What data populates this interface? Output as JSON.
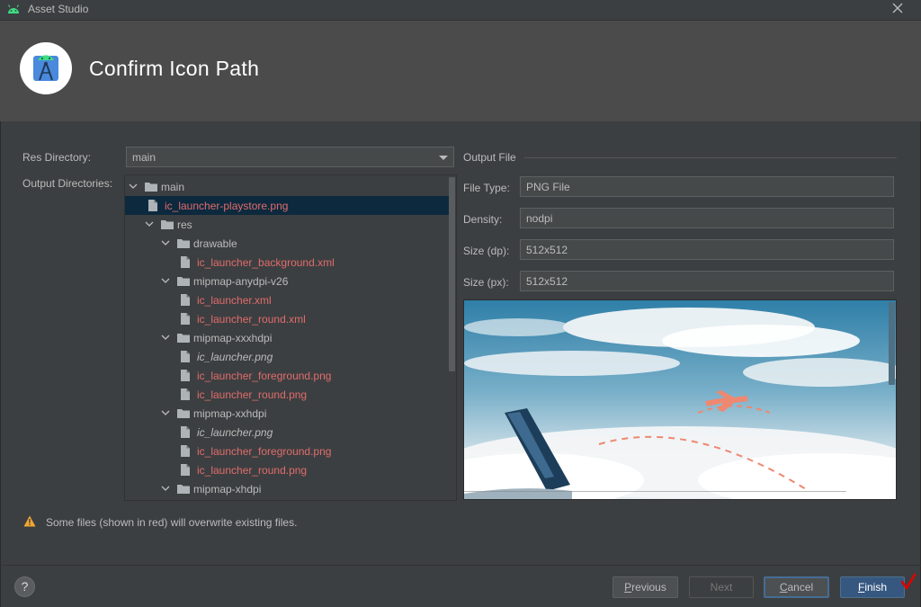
{
  "window": {
    "title": "Asset Studio"
  },
  "header": {
    "title": "Confirm Icon Path"
  },
  "form": {
    "res_directory_label": "Res Directory:",
    "res_directory_value": "main",
    "output_directories_label": "Output Directories:"
  },
  "tree": {
    "items": [
      {
        "label": "main",
        "kind": "folder",
        "depth": 0,
        "expanded": true,
        "style": "plain"
      },
      {
        "label": "ic_launcher-playstore.png",
        "kind": "file",
        "depth": 1,
        "style": "red",
        "selected": true
      },
      {
        "label": "res",
        "kind": "folder",
        "depth": 1,
        "expanded": true,
        "style": "plain"
      },
      {
        "label": "drawable",
        "kind": "folder",
        "depth": 2,
        "expanded": true,
        "style": "plain"
      },
      {
        "label": "ic_launcher_background.xml",
        "kind": "file",
        "depth": 3,
        "style": "red"
      },
      {
        "label": "mipmap-anydpi-v26",
        "kind": "folder",
        "depth": 2,
        "expanded": true,
        "style": "plain"
      },
      {
        "label": "ic_launcher.xml",
        "kind": "file",
        "depth": 3,
        "style": "red"
      },
      {
        "label": "ic_launcher_round.xml",
        "kind": "file",
        "depth": 3,
        "style": "red"
      },
      {
        "label": "mipmap-xxxhdpi",
        "kind": "folder",
        "depth": 2,
        "expanded": true,
        "style": "plain"
      },
      {
        "label": "ic_launcher.png",
        "kind": "file",
        "depth": 3,
        "style": "italic"
      },
      {
        "label": "ic_launcher_foreground.png",
        "kind": "file",
        "depth": 3,
        "style": "red"
      },
      {
        "label": "ic_launcher_round.png",
        "kind": "file",
        "depth": 3,
        "style": "red"
      },
      {
        "label": "mipmap-xxhdpi",
        "kind": "folder",
        "depth": 2,
        "expanded": true,
        "style": "plain"
      },
      {
        "label": "ic_launcher.png",
        "kind": "file",
        "depth": 3,
        "style": "italic"
      },
      {
        "label": "ic_launcher_foreground.png",
        "kind": "file",
        "depth": 3,
        "style": "red"
      },
      {
        "label": "ic_launcher_round.png",
        "kind": "file",
        "depth": 3,
        "style": "red"
      },
      {
        "label": "mipmap-xhdpi",
        "kind": "folder",
        "depth": 2,
        "expanded": true,
        "style": "plain"
      }
    ]
  },
  "output_file": {
    "section_title": "Output File",
    "file_type_label": "File Type:",
    "file_type_value": "PNG File",
    "density_label": "Density:",
    "density_value": "nodpi",
    "size_dp_label": "Size (dp):",
    "size_dp_value": "512x512",
    "size_px_label": "Size (px):",
    "size_px_value": "512x512"
  },
  "warning": {
    "text": "Some files (shown in red) will overwrite existing files."
  },
  "buttons": {
    "help": "?",
    "previous_mnemonic": "P",
    "previous_rest": "revious",
    "next": "Next",
    "cancel_mnemonic": "C",
    "cancel_rest": "ancel",
    "finish_mnemonic": "F",
    "finish_rest": "inish"
  },
  "colors": {
    "background": "#3c3f41",
    "header": "#4b4b4b",
    "overwrite_red": "#e06c6c",
    "selection": "#0d293e",
    "primary_button": "#365880",
    "warning_yellow": "#f0a732"
  }
}
